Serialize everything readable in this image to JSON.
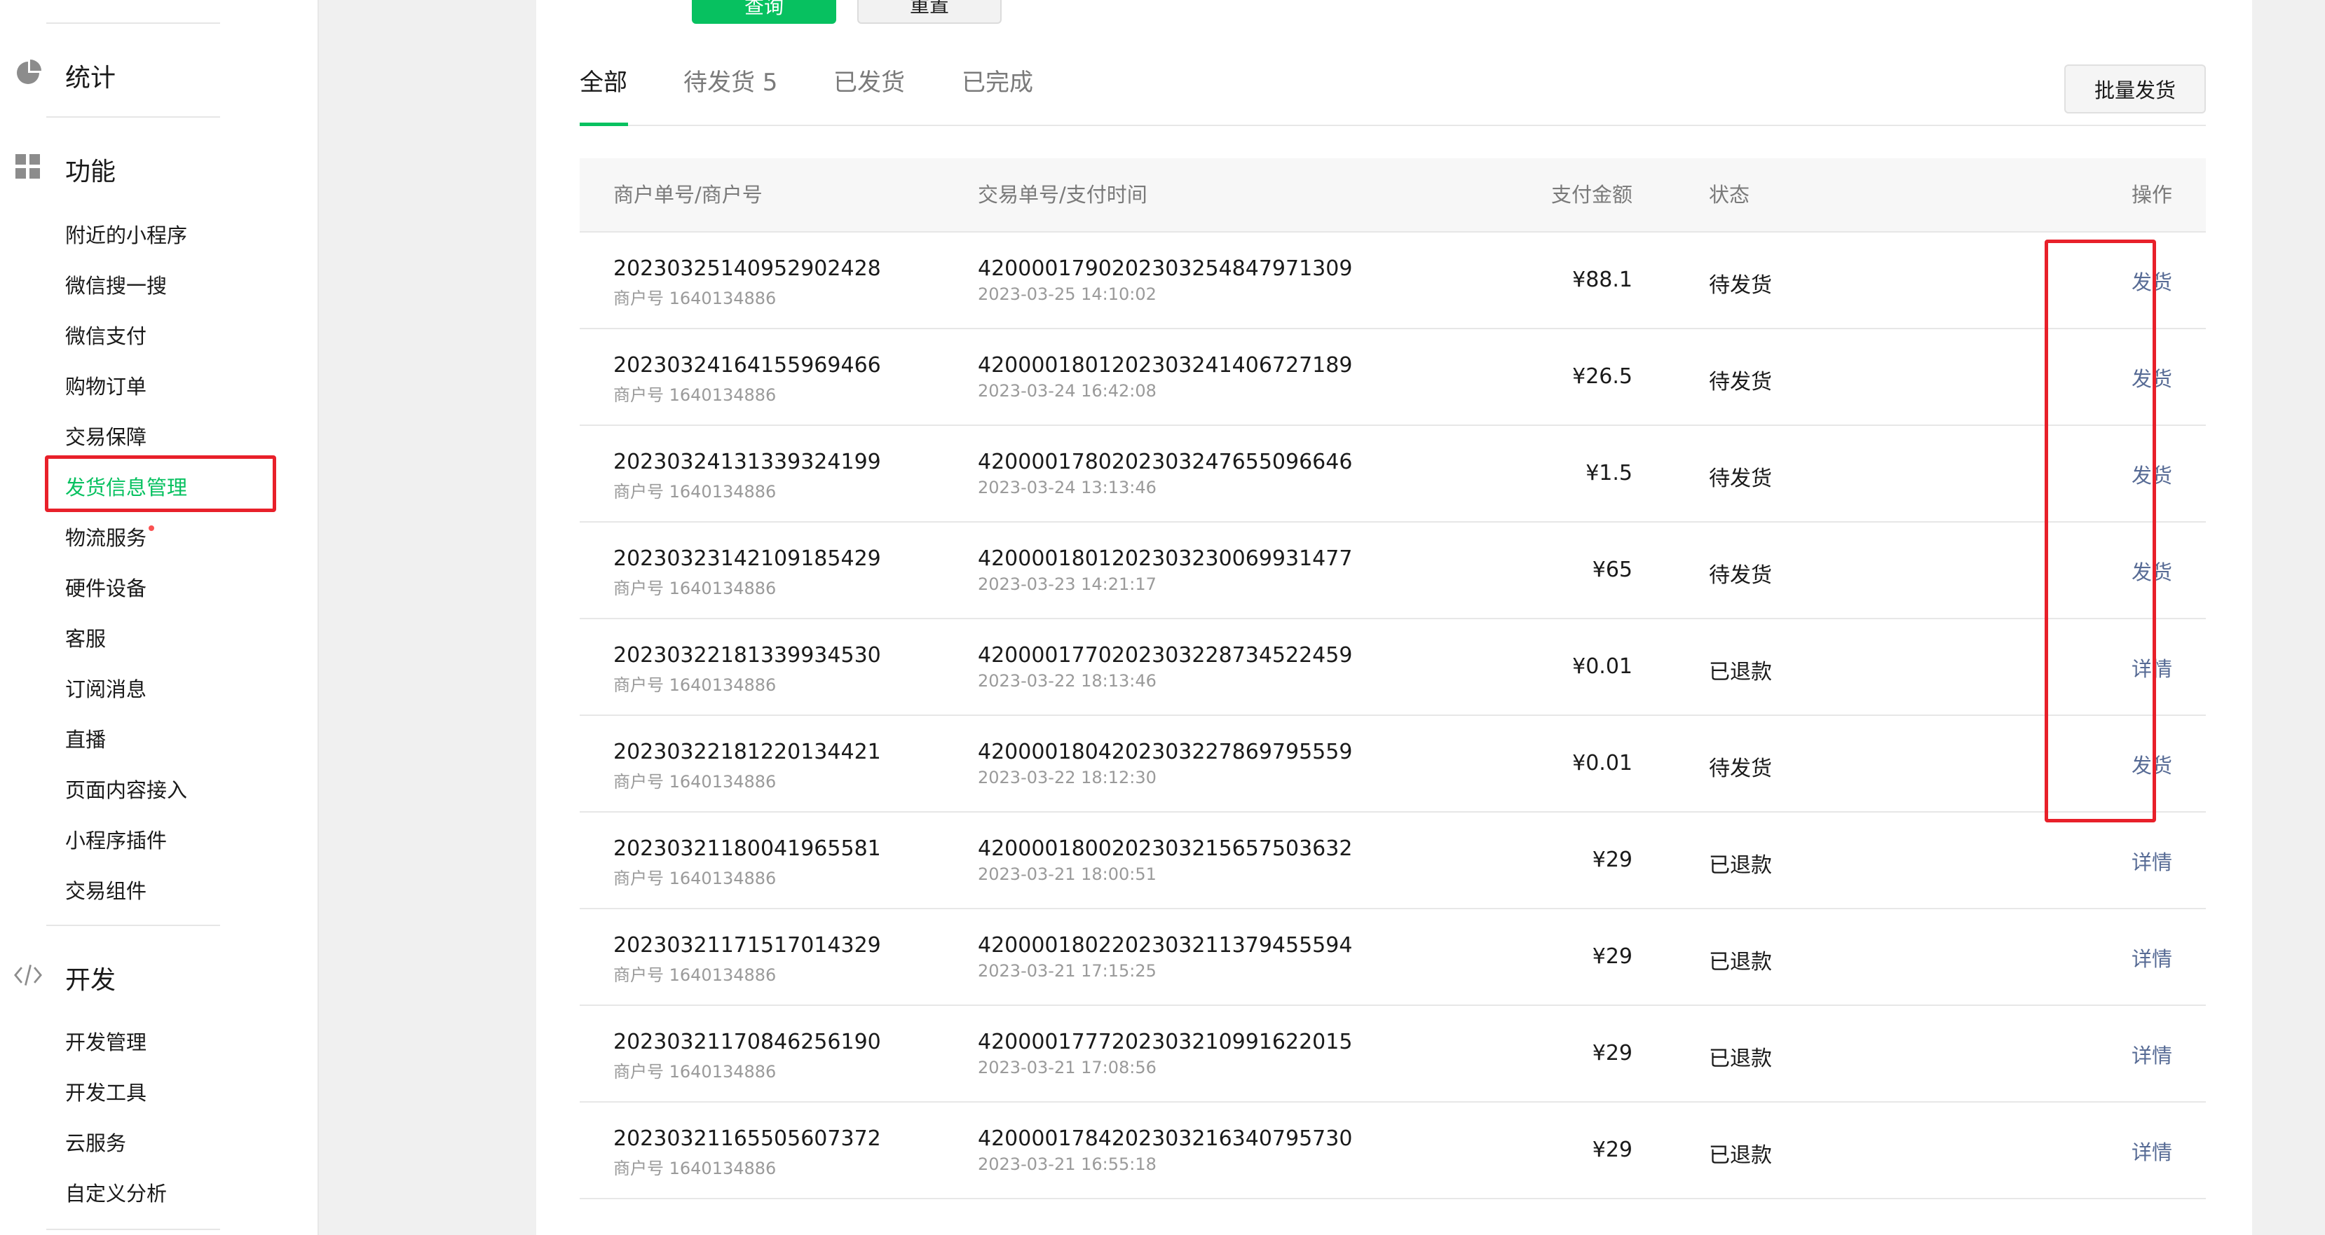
{
  "sidebar": {
    "sections": [
      {
        "label": "统计",
        "icon": "pie-chart-icon"
      },
      {
        "label": "功能",
        "icon": "grid-icon"
      },
      {
        "label": "开发",
        "icon": "code-icon"
      }
    ],
    "function_items": [
      "附近的小程序",
      "微信搜一搜",
      "微信支付",
      "购物订单",
      "交易保障",
      "发货信息管理",
      "物流服务",
      "硬件设备",
      "客服",
      "订阅消息",
      "直播",
      "页面内容接入",
      "小程序插件",
      "交易组件"
    ],
    "dev_items": [
      "开发管理",
      "开发工具",
      "云服务",
      "自定义分析"
    ],
    "active_item": "发货信息管理",
    "accent_color": "#07c160",
    "highlight_color": "#e8202a",
    "notification_dot_color": "#fa5151"
  },
  "toolbar": {
    "query_label": "查询",
    "reset_label": "重置",
    "batch_ship_label": "批量发货"
  },
  "tabs": [
    {
      "label": "全部",
      "active": true
    },
    {
      "label": "待发货 5",
      "active": false
    },
    {
      "label": "已发货",
      "active": false
    },
    {
      "label": "已完成",
      "active": false
    }
  ],
  "table": {
    "columns": [
      "商户单号/商户号",
      "交易单号/支付时间",
      "支付金额",
      "状态",
      "操作"
    ],
    "rows": [
      {
        "order_no": "20230325140952902428",
        "merchant": "商户号 1640134886",
        "trade_no": "4200001790202303254847971309",
        "pay_time": "2023-03-25 14:10:02",
        "amount": "¥88.1",
        "status": "待发货",
        "action": "发货"
      },
      {
        "order_no": "20230324164155969466",
        "merchant": "商户号 1640134886",
        "trade_no": "4200001801202303241406727189",
        "pay_time": "2023-03-24 16:42:08",
        "amount": "¥26.5",
        "status": "待发货",
        "action": "发货"
      },
      {
        "order_no": "20230324131339324199",
        "merchant": "商户号 1640134886",
        "trade_no": "4200001780202303247655096646",
        "pay_time": "2023-03-24 13:13:46",
        "amount": "¥1.5",
        "status": "待发货",
        "action": "发货"
      },
      {
        "order_no": "20230323142109185429",
        "merchant": "商户号 1640134886",
        "trade_no": "4200001801202303230069931477",
        "pay_time": "2023-03-23 14:21:17",
        "amount": "¥65",
        "status": "待发货",
        "action": "发货"
      },
      {
        "order_no": "20230322181339934530",
        "merchant": "商户号 1640134886",
        "trade_no": "4200001770202303228734522459",
        "pay_time": "2023-03-22 18:13:46",
        "amount": "¥0.01",
        "status": "已退款",
        "action": "详情"
      },
      {
        "order_no": "20230322181220134421",
        "merchant": "商户号 1640134886",
        "trade_no": "4200001804202303227869795559",
        "pay_time": "2023-03-22 18:12:30",
        "amount": "¥0.01",
        "status": "待发货",
        "action": "发货"
      },
      {
        "order_no": "20230321180041965581",
        "merchant": "商户号 1640134886",
        "trade_no": "4200001800202303215657503632",
        "pay_time": "2023-03-21 18:00:51",
        "amount": "¥29",
        "status": "已退款",
        "action": "详情"
      },
      {
        "order_no": "20230321171517014329",
        "merchant": "商户号 1640134886",
        "trade_no": "4200001802202303211379455594",
        "pay_time": "2023-03-21 17:15:25",
        "amount": "¥29",
        "status": "已退款",
        "action": "详情"
      },
      {
        "order_no": "20230321170846256190",
        "merchant": "商户号 1640134886",
        "trade_no": "4200001777202303210991622015",
        "pay_time": "2023-03-21 17:08:56",
        "amount": "¥29",
        "status": "已退款",
        "action": "详情"
      },
      {
        "order_no": "20230321165505607372",
        "merchant": "商户号 1640134886",
        "trade_no": "4200001784202303216340795730",
        "pay_time": "2023-03-21 16:55:18",
        "amount": "¥29",
        "status": "已退款",
        "action": "详情"
      }
    ],
    "link_color": "#576b95"
  }
}
